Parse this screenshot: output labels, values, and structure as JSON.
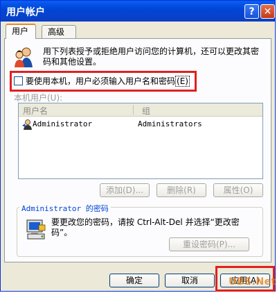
{
  "window": {
    "title": "用户帐户",
    "help_glyph": "?",
    "close_glyph": "✕"
  },
  "tabs": [
    {
      "label": "用户"
    },
    {
      "label": "高级"
    }
  ],
  "intro_text": "用下列表授予或拒绝用户访问您的计算机，还可以更改其密码和其他设置。",
  "checkbox": {
    "label": "要使用本机，用户必须输入用户名和密码",
    "hotkey": "(E)",
    "checked": false
  },
  "list": {
    "caption": "本机用户(U):",
    "columns": [
      "用户名",
      "组"
    ],
    "rows": [
      {
        "user": "Administrator",
        "group": "Administrators"
      }
    ]
  },
  "list_buttons": {
    "add": "添加(D)...",
    "remove": "删除(R)",
    "properties": "属性(O)"
  },
  "password_group": {
    "title": "Administrator 的密码",
    "text": "要更改您的密码，请按 Ctrl-Alt-Del 并选择“更改密码”。",
    "reset_button": "重设密码(P)..."
  },
  "dialog_buttons": {
    "ok": "确定",
    "cancel": "取消",
    "apply": "应用(A)"
  },
  "watermark": "UBS.Net",
  "colors": {
    "titlebar": "#0046d5",
    "highlight": "#e02020",
    "watermark": "#e37c14"
  }
}
